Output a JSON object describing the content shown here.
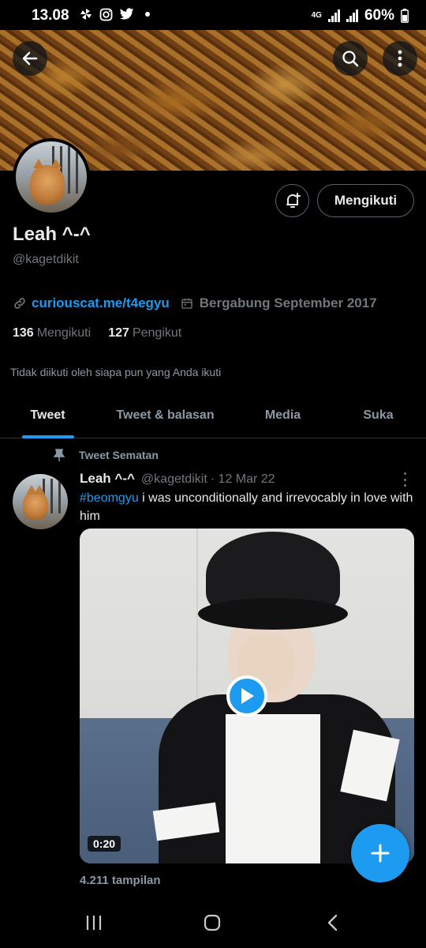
{
  "status_bar": {
    "time": "13.08",
    "network": "4G",
    "battery": "60%",
    "notification_icons": [
      "pinwheel-icon",
      "instagram-icon",
      "twitter-icon",
      "dot-icon"
    ]
  },
  "header": {
    "back_icon": "arrow-left-icon",
    "search_icon": "search-icon",
    "more_icon": "more-vertical-icon"
  },
  "profile": {
    "name": "Leah ^-^",
    "handle": "@kagetdikit",
    "link": "curiouscat.me/t4egyu",
    "joined": "Bergabung September 2017",
    "following_count": "136",
    "following_label": "Mengikuti",
    "followers_count": "127",
    "followers_label": "Pengikut",
    "mutuals_note": "Tidak diikuti oleh siapa pun yang Anda ikuti",
    "follow_button_label": "Mengikuti"
  },
  "tabs": [
    {
      "label": "Tweet",
      "active": true
    },
    {
      "label": "Tweet & balasan",
      "active": false
    },
    {
      "label": "Media",
      "active": false
    },
    {
      "label": "Suka",
      "active": false
    }
  ],
  "tweet": {
    "pinned_label": "Tweet Sematan",
    "author_name": "Leah ^-^",
    "author_handle": "@kagetdikit",
    "date": "· 12 Mar 22",
    "hashtag": "#beomgyu",
    "text": " i was unconditionally and irrevocably in love with him",
    "video_duration": "0:20",
    "views": "4.211 tampilan"
  },
  "colors": {
    "accent": "#1d9bf0",
    "background": "#000000",
    "text_primary": "#e7e9ea",
    "text_secondary": "#71767b"
  }
}
